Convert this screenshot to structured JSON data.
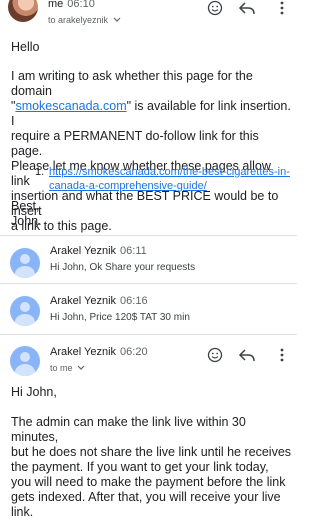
{
  "msg1": {
    "sender": "me",
    "time": "06:10",
    "to": "to arakelyeznik",
    "greeting": "Hello",
    "body_line1": "I am writing to ask whether this page for the domain",
    "body_line2_pre": "\"",
    "body_line2_link": "smokescanada.com",
    "body_line2_post": "\" is available for link insertion. I",
    "body_line3": "require a PERMANENT do-follow link for this page.",
    "body_line4": "Please let me know whether these pages allow link",
    "body_line5": "insertion and what the BEST PRICE would be to insert",
    "body_line6": "a link to this page.",
    "list_number": "1.",
    "list_link_line1": "https://smokescanada.com/the-best-cigarettes-in-",
    "list_link_line2": "canada-a-comprehensive-guide/",
    "sign_line1": "Best,",
    "sign_line2": "John."
  },
  "msg2": {
    "sender": "Arakel Yeznik",
    "time": "06:11",
    "snippet": "Hi John, Ok Share your requests"
  },
  "msg3": {
    "sender": "Arakel Yeznik",
    "time": "06:16",
    "snippet": "Hi John, Price 120$ TAT 30 min"
  },
  "msg4": {
    "sender": "Arakel Yeznik",
    "time": "06:20",
    "to": "to me",
    "greeting": "Hi John,",
    "body_line1": "The admin can make the link live within 30 minutes,",
    "body_line2": "but he does not share the live link until he receives",
    "body_line3": "the payment. If you want to get your link today,",
    "body_line4": "you will need to make the payment before the link",
    "body_line5": "gets indexed. After that, you will receive your live",
    "body_line6": "link."
  },
  "icons": {
    "emoji": "emoji-react-icon",
    "reply": "reply-icon",
    "more": "more-options-icon"
  }
}
